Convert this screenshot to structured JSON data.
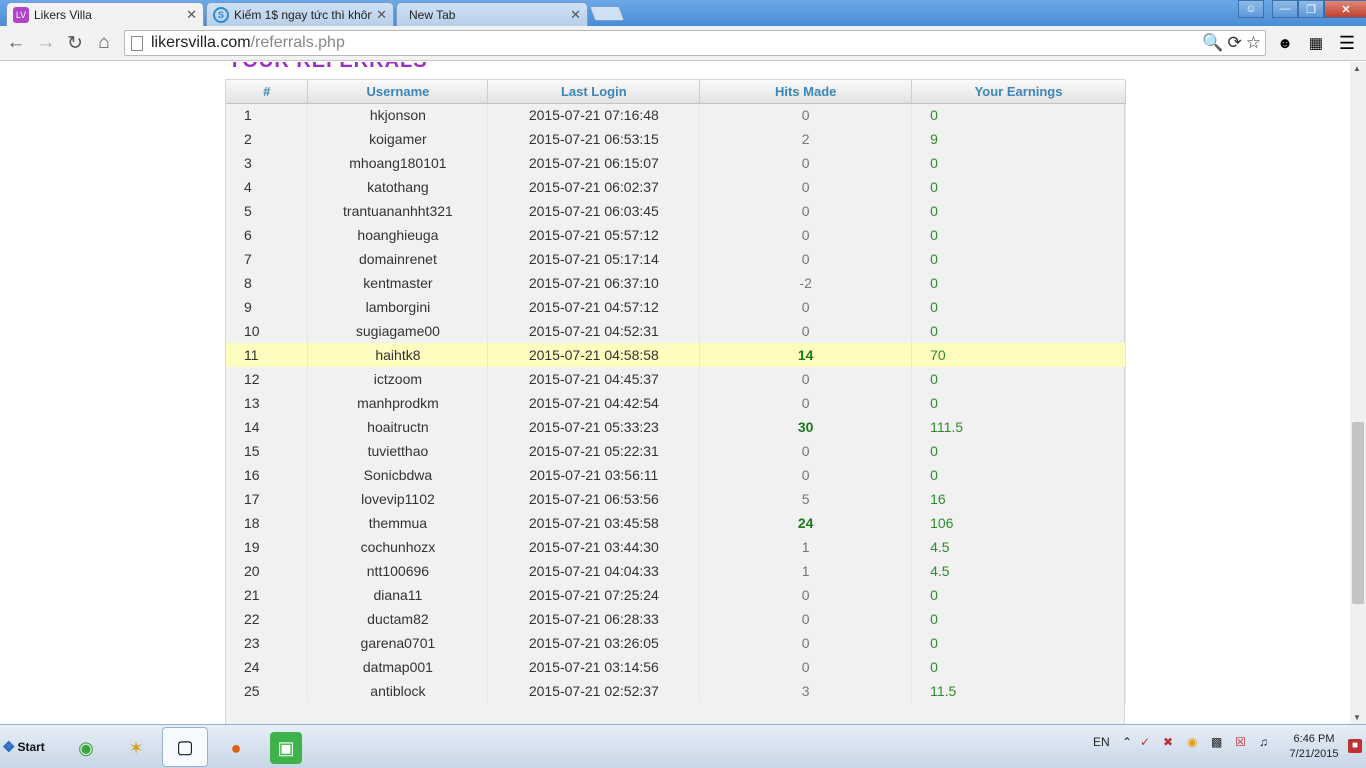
{
  "browser": {
    "tabs": [
      {
        "title": "Likers Villa",
        "active": true
      },
      {
        "title": "Kiếm 1$ ngay tức thì khôn",
        "active": false
      },
      {
        "title": "New Tab",
        "active": false
      }
    ],
    "tab_close": "✕",
    "favicon_likers": "LV",
    "favicon_kiem": "S",
    "url_host": "likersvilla.com",
    "url_path": "/referrals.php"
  },
  "page": {
    "heading": "YOUR REFERRALS",
    "columns": [
      "#",
      "Username",
      "Last Login",
      "Hits Made",
      "Your Earnings"
    ],
    "rows": [
      {
        "num": "1",
        "user": "hkjonson",
        "login": "2015-07-21 07:16:48",
        "hits": "0",
        "earn": "0"
      },
      {
        "num": "2",
        "user": "koigamer",
        "login": "2015-07-21 06:53:15",
        "hits": "2",
        "earn": "9"
      },
      {
        "num": "3",
        "user": "mhoang180101",
        "login": "2015-07-21 06:15:07",
        "hits": "0",
        "earn": "0"
      },
      {
        "num": "4",
        "user": "katothang",
        "login": "2015-07-21 06:02:37",
        "hits": "0",
        "earn": "0"
      },
      {
        "num": "5",
        "user": "trantuananhht321",
        "login": "2015-07-21 06:03:45",
        "hits": "0",
        "earn": "0"
      },
      {
        "num": "6",
        "user": "hoanghieuga",
        "login": "2015-07-21 05:57:12",
        "hits": "0",
        "earn": "0"
      },
      {
        "num": "7",
        "user": "domainrenet",
        "login": "2015-07-21 05:17:14",
        "hits": "0",
        "earn": "0"
      },
      {
        "num": "8",
        "user": "kentmaster",
        "login": "2015-07-21 06:37:10",
        "hits": "-2",
        "earn": "0"
      },
      {
        "num": "9",
        "user": "lamborgini",
        "login": "2015-07-21 04:57:12",
        "hits": "0",
        "earn": "0"
      },
      {
        "num": "10",
        "user": "sugiagame00",
        "login": "2015-07-21 04:52:31",
        "hits": "0",
        "earn": "0"
      },
      {
        "num": "11",
        "user": "haihtk8",
        "login": "2015-07-21 04:58:58",
        "hits": "14",
        "earn": "70",
        "highlight": true,
        "bold_hits": true
      },
      {
        "num": "12",
        "user": "ictzoom",
        "login": "2015-07-21 04:45:37",
        "hits": "0",
        "earn": "0"
      },
      {
        "num": "13",
        "user": "manhprodkm",
        "login": "2015-07-21 04:42:54",
        "hits": "0",
        "earn": "0"
      },
      {
        "num": "14",
        "user": "hoaitructn",
        "login": "2015-07-21 05:33:23",
        "hits": "30",
        "earn": "111.5",
        "bold_hits": true
      },
      {
        "num": "15",
        "user": "tuvietthao",
        "login": "2015-07-21 05:22:31",
        "hits": "0",
        "earn": "0"
      },
      {
        "num": "16",
        "user": "Sonicbdwa",
        "login": "2015-07-21 03:56:11",
        "hits": "0",
        "earn": "0"
      },
      {
        "num": "17",
        "user": "lovevip1102",
        "login": "2015-07-21 06:53:56",
        "hits": "5",
        "earn": "16"
      },
      {
        "num": "18",
        "user": "themmua",
        "login": "2015-07-21 03:45:58",
        "hits": "24",
        "earn": "106",
        "bold_hits": true
      },
      {
        "num": "19",
        "user": "cochunhozx",
        "login": "2015-07-21 03:44:30",
        "hits": "1",
        "earn": "4.5"
      },
      {
        "num": "20",
        "user": "ntt100696",
        "login": "2015-07-21 04:04:33",
        "hits": "1",
        "earn": "4.5"
      },
      {
        "num": "21",
        "user": "diana11",
        "login": "2015-07-21 07:25:24",
        "hits": "0",
        "earn": "0"
      },
      {
        "num": "22",
        "user": "ductam82",
        "login": "2015-07-21 06:28:33",
        "hits": "0",
        "earn": "0"
      },
      {
        "num": "23",
        "user": "garena0701",
        "login": "2015-07-21 03:26:05",
        "hits": "0",
        "earn": "0"
      },
      {
        "num": "24",
        "user": "datmap001",
        "login": "2015-07-21 03:14:56",
        "hits": "0",
        "earn": "0"
      },
      {
        "num": "25",
        "user": "antiblock",
        "login": "2015-07-21 02:52:37",
        "hits": "3",
        "earn": "11.5"
      }
    ]
  },
  "taskbar": {
    "start_label": "Start",
    "language": "EN",
    "time": "6:46 PM",
    "date": "7/21/2015"
  },
  "colors": {
    "heading": "#9b2ec4",
    "header_text": "#3d86b8",
    "earnings": "#2e8b2e",
    "highlight_row": "#fffcc0"
  }
}
